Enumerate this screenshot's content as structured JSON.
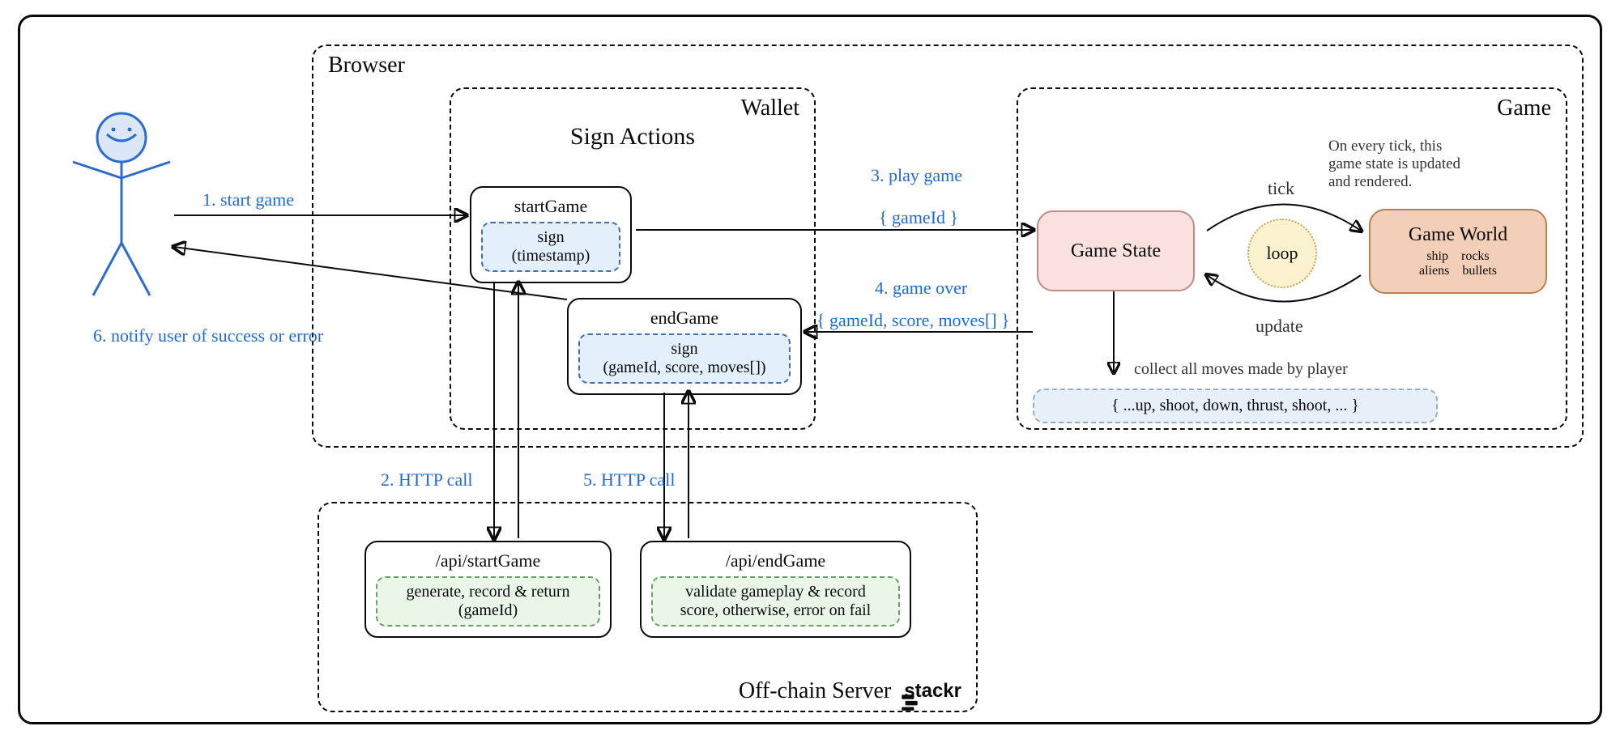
{
  "outer": {},
  "browser": {
    "title": "Browser"
  },
  "wallet": {
    "title": "Wallet",
    "signActions": "Sign Actions",
    "startGame": {
      "title": "startGame",
      "signLine1": "sign",
      "signLine2": "(timestamp)"
    },
    "endGame": {
      "title": "endGame",
      "signLine1": "sign",
      "signLine2": "(gameId, score, moves[])"
    }
  },
  "game": {
    "title": "Game",
    "state": "Game State",
    "world": "Game World",
    "worldItems": "ship    rocks\naliens    bullets",
    "loop": "loop",
    "tick": "tick",
    "update": "update",
    "tickNote": "On every tick, this\ngame state is updated\nand rendered.",
    "collectNote": "collect all moves made by player",
    "moves": "{ ...up, shoot, down, thrust, shoot, ... }"
  },
  "server": {
    "title": "Off-chain Server",
    "logo": "stackr",
    "apiStart": {
      "title": "/api/startGame",
      "body": "generate, record & return\n(gameId)"
    },
    "apiEnd": {
      "title": "/api/endGame",
      "body": "validate gameplay & record\nscore, otherwise, error on fail"
    }
  },
  "edges": {
    "e1": "1. start game",
    "e2": "2. HTTP call",
    "e3_top": "3. play game",
    "e3_sub": "{ gameId }",
    "e4_top": "4. game over",
    "e4_sub": "{ gameId, score, moves[] }",
    "e5": "5. HTTP call",
    "e6": "6. notify user of success or error"
  }
}
